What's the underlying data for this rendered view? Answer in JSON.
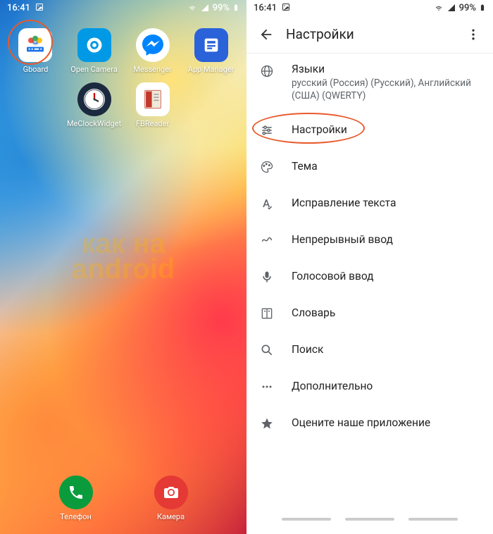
{
  "left": {
    "status": {
      "time": "16:41",
      "battery": "99%"
    },
    "apps": [
      {
        "name": "Gboard",
        "icon": "gboard"
      },
      {
        "name": "Open Camera",
        "icon": "opencam"
      },
      {
        "name": "Messenger",
        "icon": "messenger"
      },
      {
        "name": "App Manager",
        "icon": "appmgr"
      },
      {
        "name": "MeClockWidget",
        "icon": "clock"
      },
      {
        "name": "FBReader",
        "icon": "fbreader"
      }
    ],
    "dock": [
      {
        "name": "Телефон",
        "icon": "phone"
      },
      {
        "name": "Камера",
        "icon": "camera"
      }
    ]
  },
  "right": {
    "status": {
      "time": "16:41",
      "battery": "99%"
    },
    "header": {
      "title": "Настройки"
    },
    "items": [
      {
        "title": "Языки",
        "sub": "русский (Россия) (Русский), Английский (США) (QWERTY)"
      },
      {
        "title": "Настройки"
      },
      {
        "title": "Тема"
      },
      {
        "title": "Исправление текста"
      },
      {
        "title": "Непрерывный ввод"
      },
      {
        "title": "Голосовой ввод"
      },
      {
        "title": "Словарь"
      },
      {
        "title": "Поиск"
      },
      {
        "title": "Дополнительно"
      },
      {
        "title": "Оцените наше приложение"
      }
    ]
  }
}
